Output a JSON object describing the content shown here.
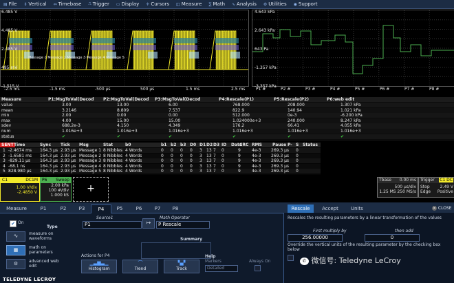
{
  "menubar": {
    "items": [
      {
        "icon": "file-icon",
        "label": "File"
      },
      {
        "icon": "vertical-icon",
        "label": "Vertical"
      },
      {
        "icon": "timebase-icon",
        "label": "Timebase"
      },
      {
        "icon": "trigger-icon",
        "label": "Trigger"
      },
      {
        "icon": "display-icon",
        "label": "Display"
      },
      {
        "icon": "cursors-icon",
        "label": "Cursors"
      },
      {
        "icon": "measure-icon",
        "label": "Measure"
      },
      {
        "icon": "math-icon",
        "label": "Math"
      },
      {
        "icon": "analysis-icon",
        "label": "Analysis"
      },
      {
        "icon": "utilities-icon",
        "label": "Utilities"
      },
      {
        "icon": "support-icon",
        "label": "Support"
      }
    ]
  },
  "left_grid": {
    "y_labels": [
      "6.485 V",
      "4.485 V",
      "2.485 V",
      "485 mV",
      "-1.515 V"
    ],
    "x_labels": [
      "-2.5 ms",
      "-1.5 ms",
      "-500 µs",
      "500 µs",
      "1.5 ms",
      "2.5 ms"
    ],
    "trace_text": "Message 1 Message 2 Message 3 Message 4 Message 5"
  },
  "right_grid": {
    "y_labels": [
      "4.643 kPa",
      "2.643 kPa",
      "643 Pa",
      "-1.357 kPa",
      "-3.357 kPa"
    ],
    "x_labels": [
      "P1 #",
      "P2 #",
      "P3 #",
      "P4 #",
      "P5 #",
      "P6 #",
      "P7 #",
      "P8 #"
    ]
  },
  "measure": {
    "headers": [
      "Measure",
      "P1:MsgToVal(Decod",
      "P2:MsgToVal(Decod",
      "P3:MsgToVal(Decod",
      "P4:Rescale(P1)",
      "P5:Rescale(P2)",
      "P6:web edit"
    ],
    "rows": [
      [
        "value",
        "3.00",
        "13.00",
        "6.00",
        "768.000",
        "208.000",
        "1.307 kPa"
      ],
      [
        "mean",
        "3.2146",
        "8.809",
        "7.537",
        "822.9",
        "140.94",
        "1.021 kPa"
      ],
      [
        "min",
        "2.00",
        "0.00",
        "0.00",
        "512.000",
        "0e-3",
        "-6.200 kPa"
      ],
      [
        "max",
        "4.00",
        "15.00",
        "15.00",
        "1.024000e+3",
        "240.000",
        "8.247 kPa"
      ],
      [
        "sdev",
        "688.2e-3",
        "4.150",
        "4.349",
        "176.2",
        "66.41",
        "4.055 kPa"
      ],
      [
        "num",
        "1.016e+3",
        "1.016e+3",
        "1.016e+3",
        "1.016e+3",
        "1.016e+3",
        "1.016e+3"
      ],
      [
        "status",
        "✔",
        "✔",
        "✔",
        "✔",
        "✔",
        "✔"
      ]
    ]
  },
  "decode": {
    "headers": [
      "SENT",
      "Time",
      "Sync",
      "Tick",
      "Msg",
      "Stat",
      "b0",
      "b1",
      "b2",
      "b3",
      "D0",
      "D1",
      "D2",
      "D3",
      "ID",
      "Data",
      "CRC",
      "RMS",
      "Pause",
      "P-",
      "S",
      "Status"
    ],
    "rows": [
      [
        "1",
        "-2.4674 ms",
        "164.3 µs",
        "2.93 µs",
        "Message 1",
        "8 Nibbles",
        "4 Words",
        "0",
        "0",
        "0",
        "0",
        "3",
        "13",
        "7",
        "0",
        "9",
        "4e-3",
        "269.3 µs",
        "0"
      ],
      [
        "2",
        "-1.6581 ms",
        "164.3 µs",
        "2.93 µs",
        "Message 2",
        "8 Nibbles",
        "4 Words",
        "0",
        "0",
        "0",
        "0",
        "3",
        "13",
        "7",
        "0",
        "9",
        "4e-3",
        "269.3 µs",
        "0"
      ],
      [
        "3",
        "-829.11 µs",
        "164.3 µs",
        "2.93 µs",
        "Message 3",
        "8 Nibbles",
        "4 Words",
        "0",
        "0",
        "0",
        "0",
        "3",
        "13",
        "7",
        "0",
        "9",
        "4e-3",
        "269.3 µs",
        "0"
      ],
      [
        "4",
        "-68.1 ns",
        "164.3 µs",
        "2.93 µs",
        "Message 4",
        "8 Nibbles",
        "4 Words",
        "0",
        "0",
        "0",
        "0",
        "3",
        "13",
        "7",
        "0",
        "9",
        "4e-3",
        "269.3 µs",
        "0"
      ],
      [
        "5",
        "828.980 µs",
        "164.3 µs",
        "2.93 µs",
        "Message 5",
        "8 Nibbles",
        "4 Words",
        "0",
        "0",
        "0",
        "0",
        "3",
        "13",
        "7",
        "0",
        "9",
        "4e-3",
        "269.3 µs",
        "0"
      ]
    ]
  },
  "channels": {
    "c1": {
      "tag": "C1",
      "badge": "DC1M",
      "l1": "1.00 V/div",
      "l2": "-2.4850 V"
    },
    "p6": {
      "tag": "P6",
      "badge": "Sweep",
      "l1": "2.00 kPa",
      "l2": "100 #/div",
      "l3": "1.000 kS"
    },
    "tbase": {
      "tag": "Tbase",
      "val": "0.00 ms",
      "l1": "500 µs/div",
      "l2": "1.25 MS  250 MS/s"
    },
    "trigger": {
      "tag": "Trigger",
      "badge": "C1 DC",
      "l1": "Stop",
      "v1": "2.49 V",
      "l2": "Edge",
      "v2": "Positive"
    }
  },
  "dialog": {
    "tabs": [
      "Measure",
      "P1",
      "P2",
      "P3",
      "P4",
      "P5",
      "P6",
      "P7",
      "P8"
    ],
    "right_tabs": [
      "Rescale",
      "Accept",
      "Units"
    ],
    "close_label": "CLOSE",
    "on_label": "On",
    "type_label": "Type",
    "type_options": [
      "measure on waveforms",
      "math on parameters",
      "advanced web edit"
    ],
    "source_label": "Source1",
    "source_value": "P1",
    "operator_label": "Math Operator",
    "operator_value": "P Rescale",
    "summary_label": "Summary",
    "actions_label": "Actions for P4",
    "help_label": "Help",
    "action_buttons": [
      "Histogram",
      "Trend",
      "Track"
    ],
    "markers_label": "Markers",
    "markers_value": "Detailed",
    "always_on_label": "Always On",
    "rescale_desc": "Rescales the resulting parameters by a linear transformation of the values",
    "first_multiply_label": "First multiply by",
    "first_multiply_value": "256.00000",
    "then_add_label": "then add",
    "then_add_value": "0",
    "override_text": "Override the vertical units of the resulting parameter by the checking box below"
  },
  "footer": {
    "logo": "TELEDYNE LECROY"
  },
  "watermark": "微信号: Teledyne LeCroy",
  "colors": {
    "ch1": "#f2e92a",
    "p6": "#4caf50",
    "accent": "#2f6fb6",
    "sent_tag": "#d61f1f"
  }
}
